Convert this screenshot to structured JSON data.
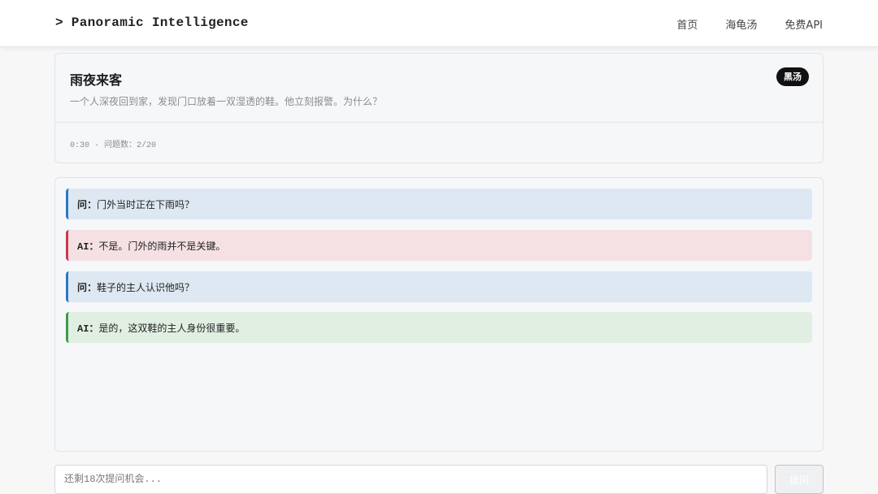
{
  "header": {
    "brand": "> Panoramic Intelligence",
    "nav": [
      "首页",
      "海龟汤",
      "免费API"
    ]
  },
  "puzzle": {
    "title": "雨夜来客",
    "badge": "黑汤",
    "description": "一个人深夜回到家，发现门口放着一双湿透的鞋。他立刻报警。为什么？",
    "meta": "0:30 · 问题数：2/20"
  },
  "chat": [
    {
      "type": "question",
      "prefix": "问：",
      "text": "门外当时正在下雨吗？"
    },
    {
      "type": "ai-no",
      "prefix": "AI：",
      "text": "不是。门外的雨并不是关键。"
    },
    {
      "type": "question",
      "prefix": "问：",
      "text": "鞋子的主人认识他吗？"
    },
    {
      "type": "ai-yes",
      "prefix": "AI：",
      "text": "是的，这双鞋的主人身份很重要。"
    }
  ],
  "input": {
    "placeholder": "还剩18次提问机会...",
    "submit_label": "提问"
  },
  "colors": {
    "question_accent": "#2a78c2",
    "ai_no_accent": "#c8394a",
    "ai_yes_accent": "#3a9a4d",
    "badge_bg": "#111111"
  }
}
